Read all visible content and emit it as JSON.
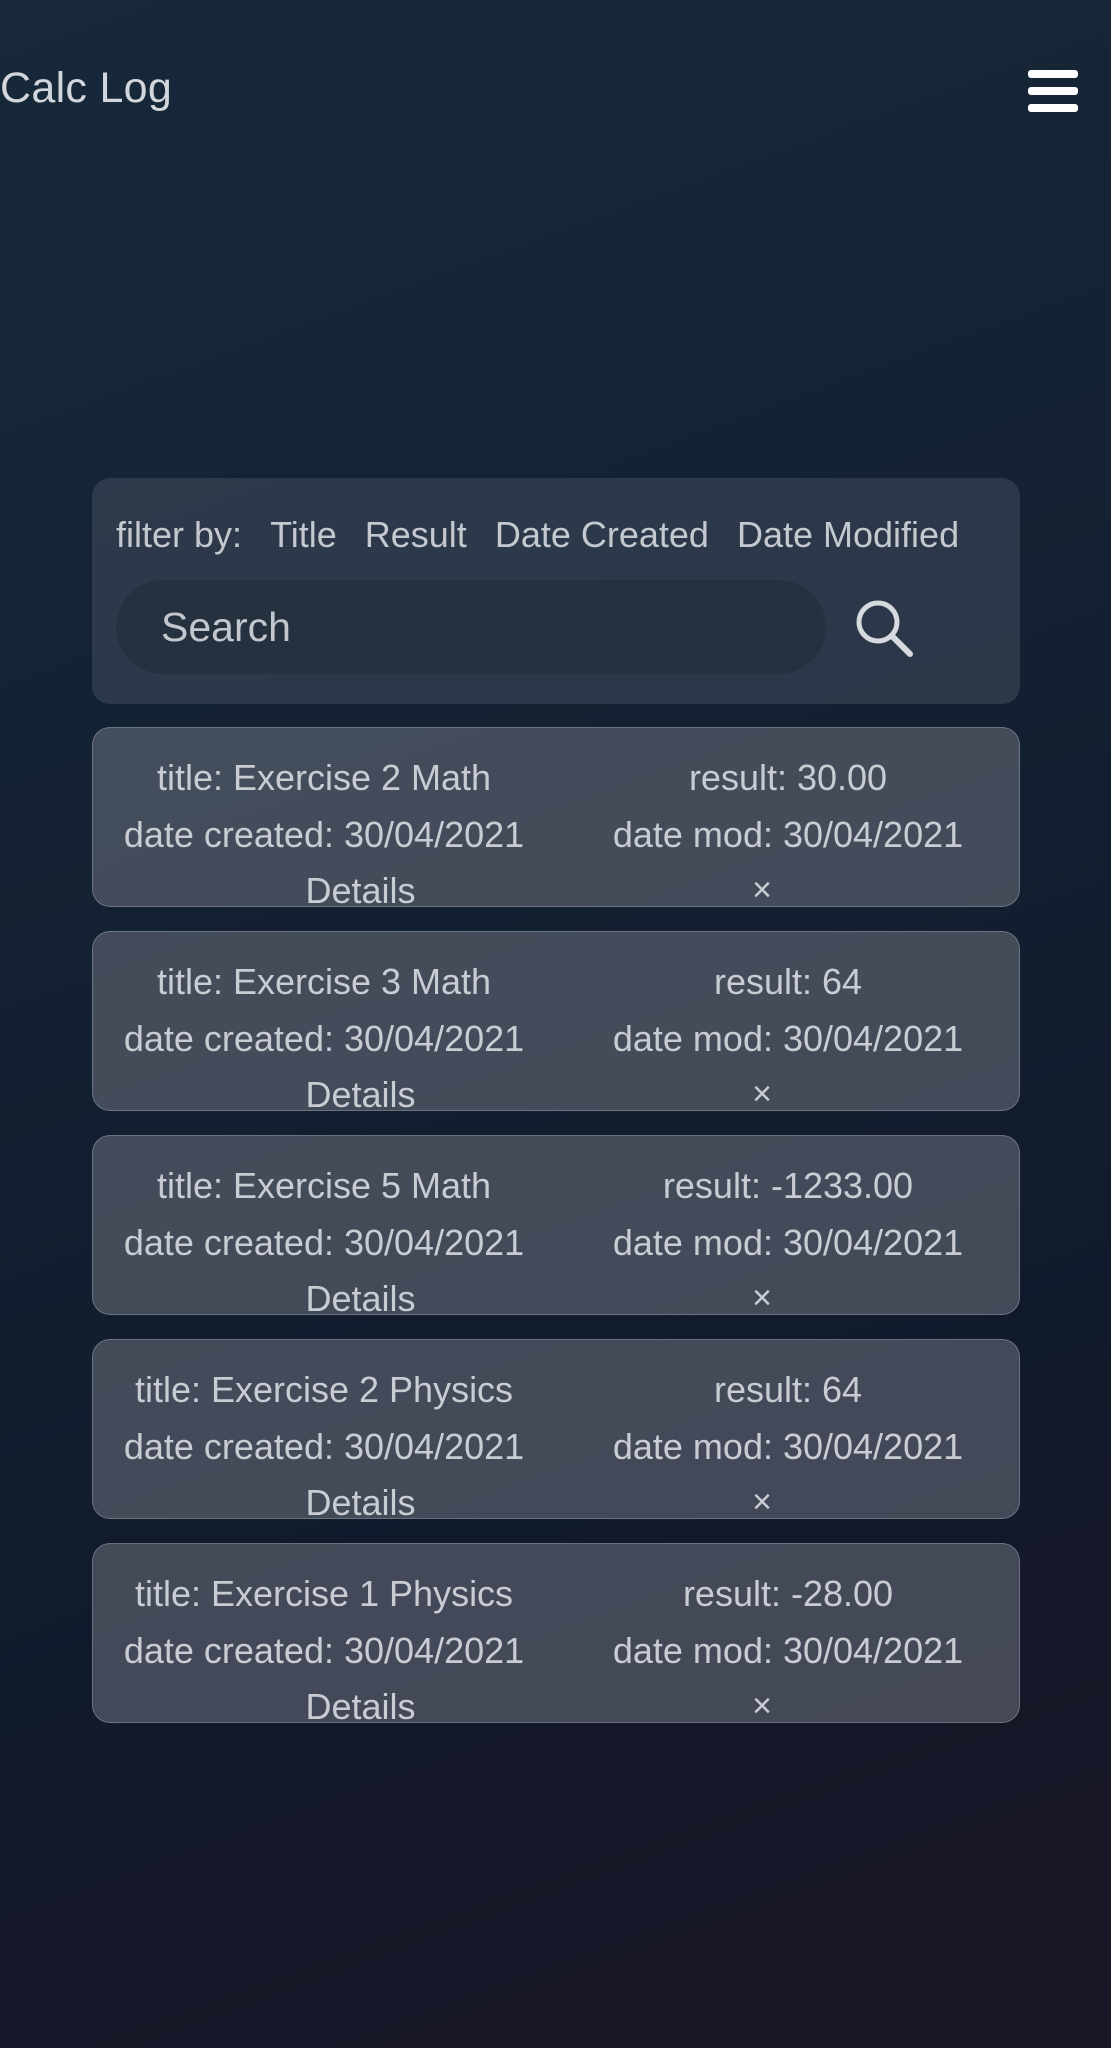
{
  "app": {
    "title": "Calc Log"
  },
  "menu": {
    "icon": "hamburger-menu-icon"
  },
  "filter": {
    "label": "filter by:",
    "options": [
      "Title",
      "Result",
      "Date Created",
      "Date Modified"
    ]
  },
  "search": {
    "placeholder": "Search",
    "value": "",
    "icon": "search-icon"
  },
  "entries": [
    {
      "title": "title: Exercise 2 Math",
      "result": "result: 30.00",
      "created": "date created: 30/04/2021",
      "modified": "date mod: 30/04/2021",
      "details": "Details",
      "delete": "×"
    },
    {
      "title": "title: Exercise 3 Math",
      "result": "result: 64",
      "created": "date created: 30/04/2021",
      "modified": "date mod: 30/04/2021",
      "details": "Details",
      "delete": "×"
    },
    {
      "title": "title: Exercise 5 Math",
      "result": "result: -1233.00",
      "created": "date created: 30/04/2021",
      "modified": "date mod: 30/04/2021",
      "details": "Details",
      "delete": "×"
    },
    {
      "title": "title: Exercise 2 Physics",
      "result": "result: 64",
      "created": "date created: 30/04/2021",
      "modified": "date mod: 30/04/2021",
      "details": "Details",
      "delete": "×"
    },
    {
      "title": "title: Exercise 1 Physics",
      "result": "result: -28.00",
      "created": "date created: 30/04/2021",
      "modified": "date mod: 30/04/2021",
      "details": "Details",
      "delete": "×"
    }
  ]
}
